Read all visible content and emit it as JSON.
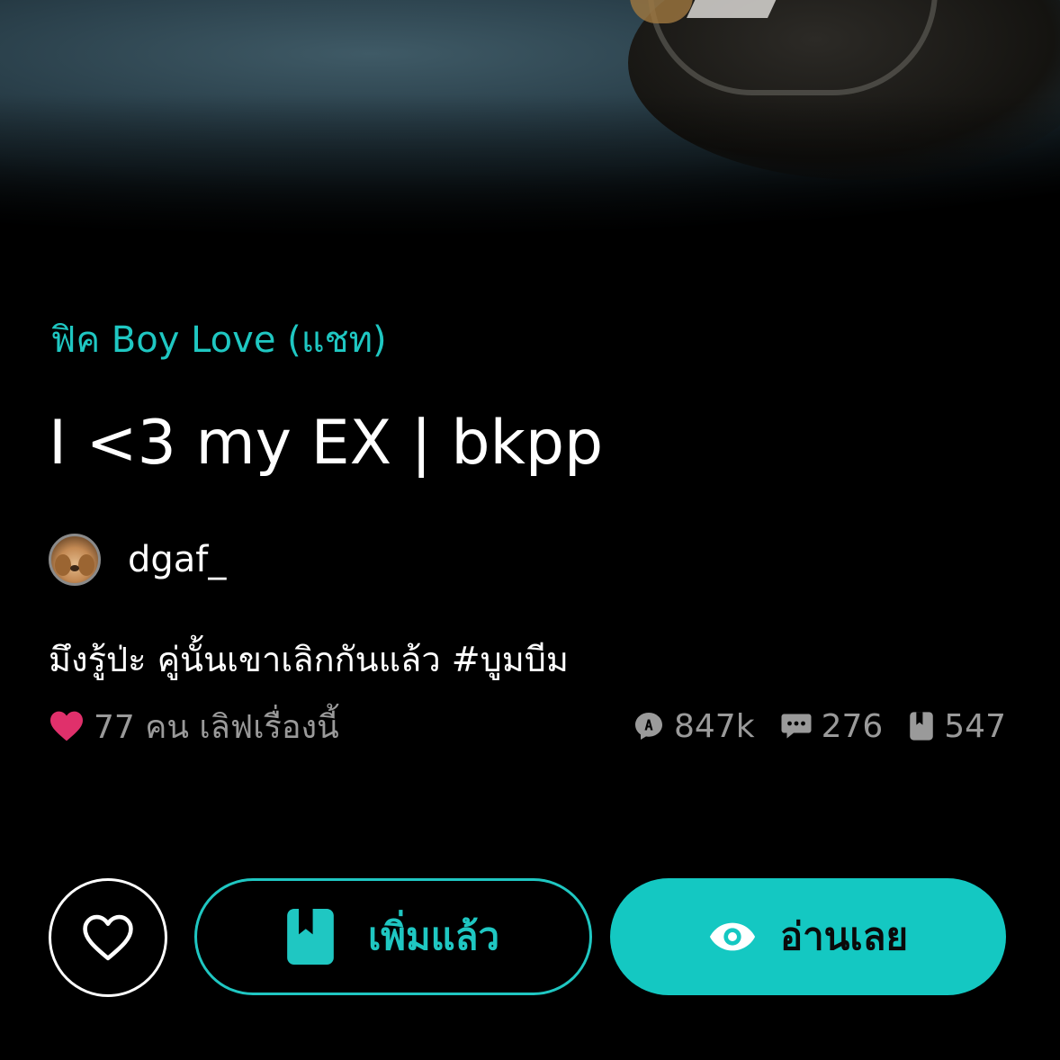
{
  "story": {
    "category": "ฟิค Boy Love (แชท)",
    "title": "I <3 my EX | bkpp",
    "author": "dgaf_",
    "description": "มึงรู้ป่ะ คู่นั้นเขาเลิกกันแล้ว #บูมบีม"
  },
  "stats": {
    "likes_text": "77 คน เลิฟเรื่องนี้",
    "views": "847k",
    "comments": "276",
    "bookmarks": "547",
    "icons": {
      "likes": "heart-icon",
      "views": "views-icon",
      "comments": "comment-icon",
      "bookmarks": "bookmark-icon"
    }
  },
  "actions": {
    "library_label": "เพิ่มแล้ว",
    "read_label": "อ่านเลย",
    "icons": {
      "favorite": "heart-outline-icon",
      "library": "book-icon",
      "read": "eye-icon"
    }
  },
  "colors": {
    "accent": "#1fc7c2",
    "background": "#000000",
    "like_heart": "#e0306b",
    "muted_text": "#9a9a9a"
  }
}
